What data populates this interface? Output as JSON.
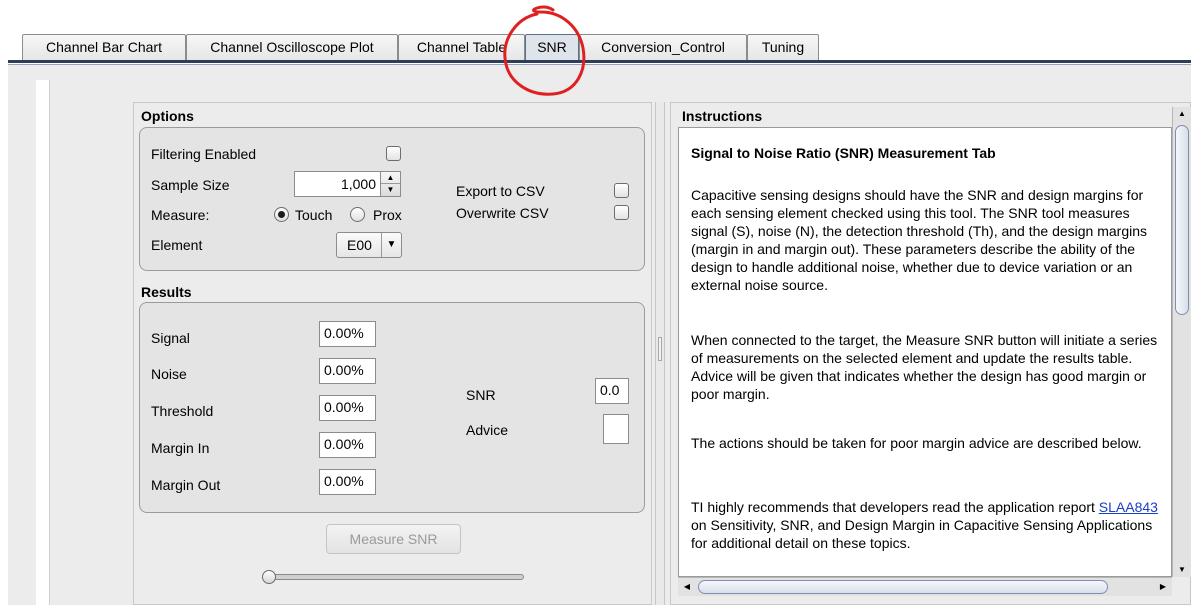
{
  "tabs": [
    {
      "label": "Channel Bar Chart",
      "active": false
    },
    {
      "label": "Channel Oscilloscope Plot",
      "active": false
    },
    {
      "label": "Channel Table",
      "active": false
    },
    {
      "label": "SNR",
      "active": true
    },
    {
      "label": "Conversion_Control",
      "active": false
    },
    {
      "label": "Tuning",
      "active": false
    }
  ],
  "options": {
    "title": "Options",
    "filtering_label": "Filtering Enabled",
    "filtering_checked": false,
    "sample_size_label": "Sample Size",
    "sample_size_value": "1,000",
    "measure_label": "Measure:",
    "measure_touch_label": "Touch",
    "measure_prox_label": "Prox",
    "measure_selected": "Touch",
    "element_label": "Element",
    "element_value": "E00",
    "export_csv_label": "Export to CSV",
    "export_csv_checked": false,
    "overwrite_csv_label": "Overwrite CSV",
    "overwrite_csv_checked": false
  },
  "results": {
    "title": "Results",
    "signal_label": "Signal",
    "signal_value": "0.00%",
    "noise_label": "Noise",
    "noise_value": "0.00%",
    "threshold_label": "Threshold",
    "threshold_value": "0.00%",
    "margin_in_label": "Margin In",
    "margin_in_value": "0.00%",
    "margin_out_label": "Margin Out",
    "margin_out_value": "0.00%",
    "snr_label": "SNR",
    "snr_value": "0.0",
    "advice_label": "Advice",
    "advice_value": ""
  },
  "measure_button_label": "Measure SNR",
  "instructions": {
    "title": "Instructions",
    "heading": "Signal to Noise Ratio (SNR) Measurement Tab",
    "para1": "Capacitive sensing designs should have the SNR and design margins for each sensing element checked using this tool. The SNR tool measures signal (S), noise (N), the detection threshold (Th), and the design margins (margin in and margin out). These parameters describe the ability of the design to handle additional noise, whether due to device variation or an external noise source.",
    "para2": "When connected to the target, the Measure SNR button will initiate a series of measurements on the selected element and update the results table. Advice will be given that indicates whether the design has good margin or poor margin.",
    "para3": "The actions should be taken for poor margin advice are described below.",
    "para4_before": "TI highly recommends that developers read the application report ",
    "para4_link": "SLAA843",
    "para4_after": " on Sensitivity, SNR, and Design Margin in Capacitive Sensing Applications for additional detail on these topics."
  },
  "colors": {
    "annotation": "#e02020",
    "link": "#1a3ec7",
    "tab_underline": "#2e3d5c"
  }
}
